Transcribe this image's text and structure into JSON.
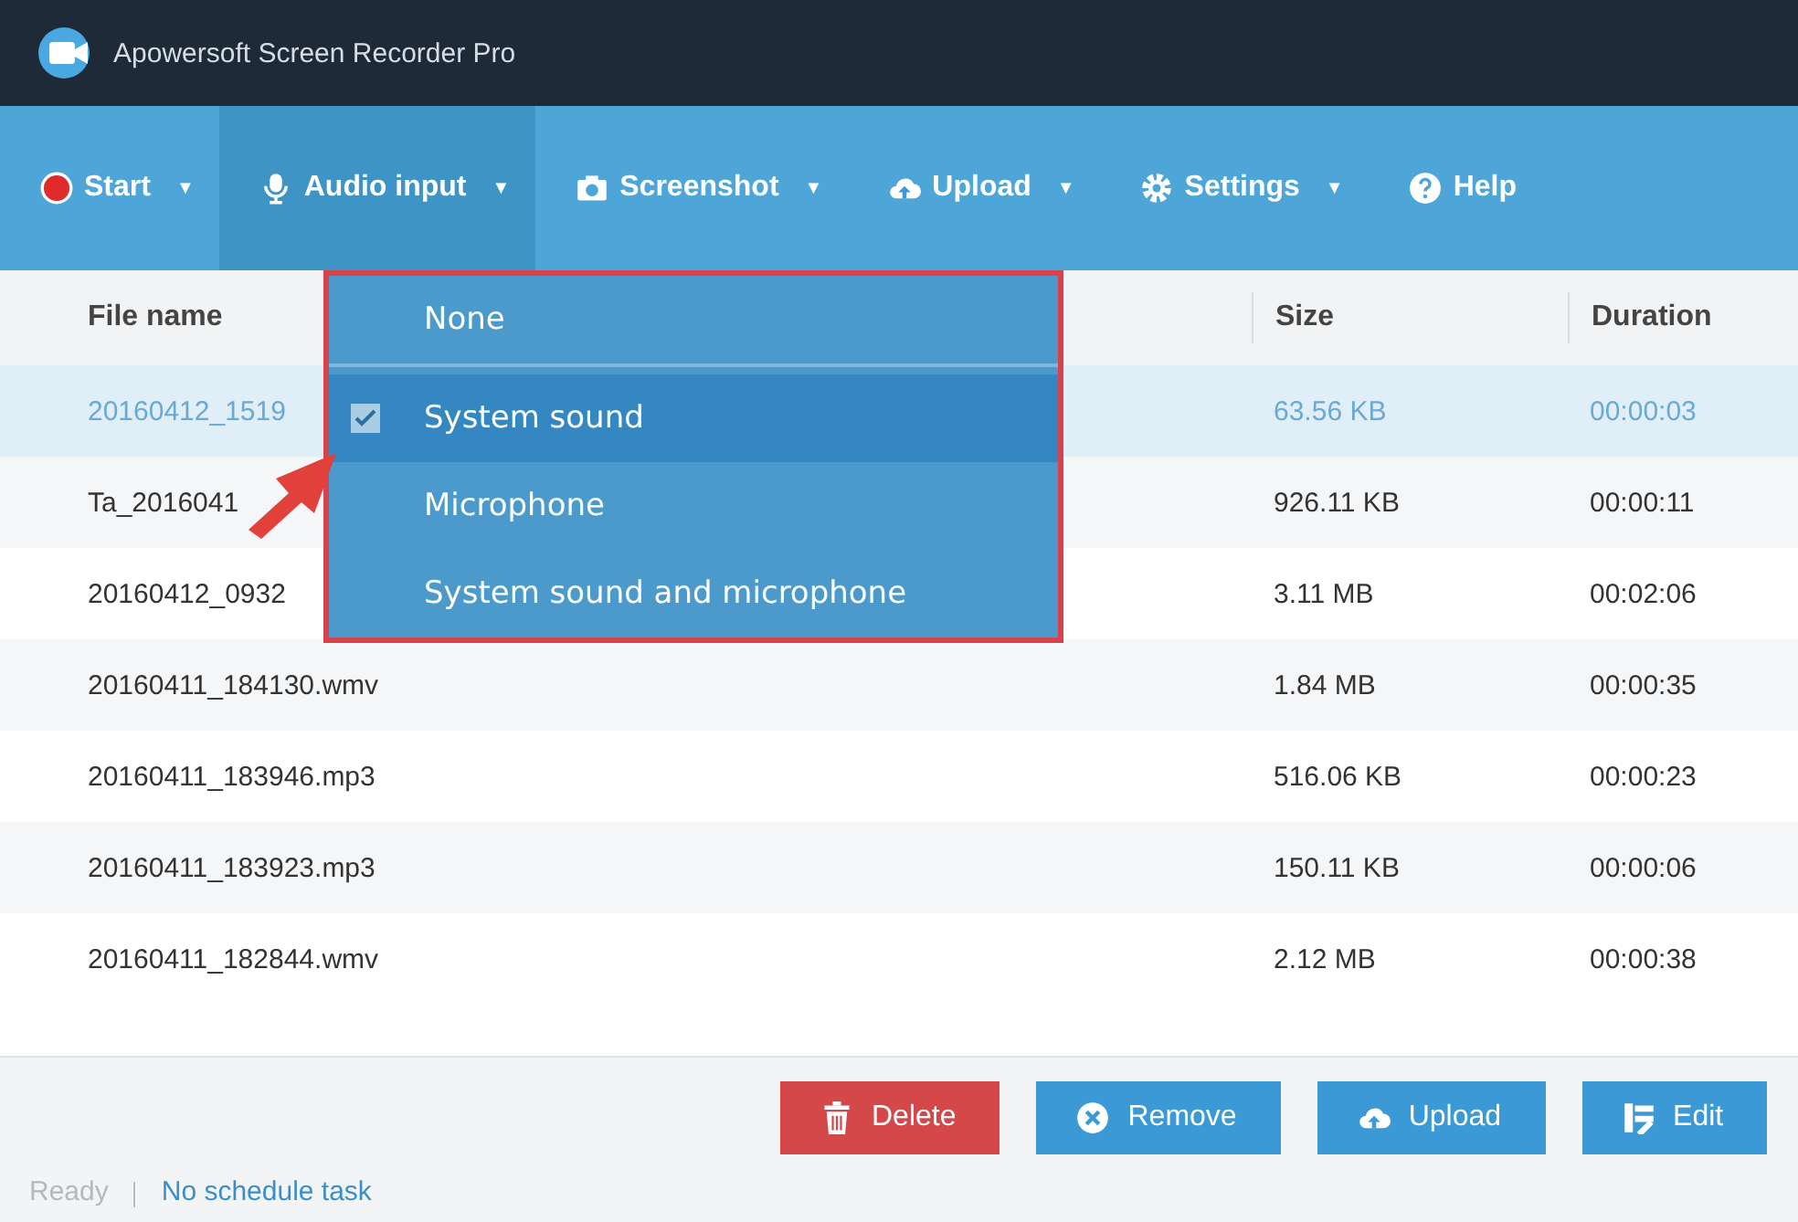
{
  "window": {
    "title": "Apowersoft Screen Recorder Pro"
  },
  "toolbar": [
    {
      "label": "Start",
      "caret": "▼",
      "selected": false
    },
    {
      "label": "Audio input",
      "caret": "▼",
      "selected": true
    },
    {
      "label": "Screenshot",
      "caret": "▼",
      "selected": false
    },
    {
      "label": "Upload",
      "caret": "▼",
      "selected": false
    },
    {
      "label": "Settings",
      "caret": "▼",
      "selected": false
    },
    {
      "label": "Help",
      "selected": false
    }
  ],
  "audio_menu": [
    {
      "label": "None",
      "checked": false,
      "selected": false
    },
    {
      "label": "System sound",
      "checked": true,
      "selected": true
    },
    {
      "label": "Microphone",
      "checked": false,
      "selected": false
    },
    {
      "label": "System sound and microphone",
      "checked": false,
      "selected": false
    }
  ],
  "table": {
    "columns": [
      "File name",
      "Size",
      "Duration"
    ],
    "rows": [
      {
        "cells": [
          "20160412_1519",
          "63.56 KB",
          "00:00:03"
        ],
        "selected": true
      },
      {
        "cells": [
          "Ta_2016041",
          "926.11 KB",
          "00:00:11"
        ],
        "selected": false
      },
      {
        "cells": [
          "20160412_0932",
          "3.11 MB",
          "00:02:06"
        ],
        "selected": false
      },
      {
        "cells": [
          "20160411_184130.wmv",
          "1.84 MB",
          "00:00:35"
        ],
        "selected": false
      },
      {
        "cells": [
          "20160411_183946.mp3",
          "516.06 KB",
          "00:00:23"
        ],
        "selected": false
      },
      {
        "cells": [
          "20160411_183923.mp3",
          "150.11 KB",
          "00:00:06"
        ],
        "selected": false
      },
      {
        "cells": [
          "20160411_182844.wmv",
          "2.12 MB",
          "00:00:38"
        ],
        "selected": false
      }
    ]
  },
  "actions": [
    {
      "label": "Delete",
      "kind": "danger"
    },
    {
      "label": "Remove",
      "kind": "primary"
    },
    {
      "label": "Upload",
      "kind": "primary"
    },
    {
      "label": "Edit",
      "kind": "primary"
    }
  ],
  "status_bar": {
    "state": "Ready",
    "schedule": "No schedule task"
  }
}
